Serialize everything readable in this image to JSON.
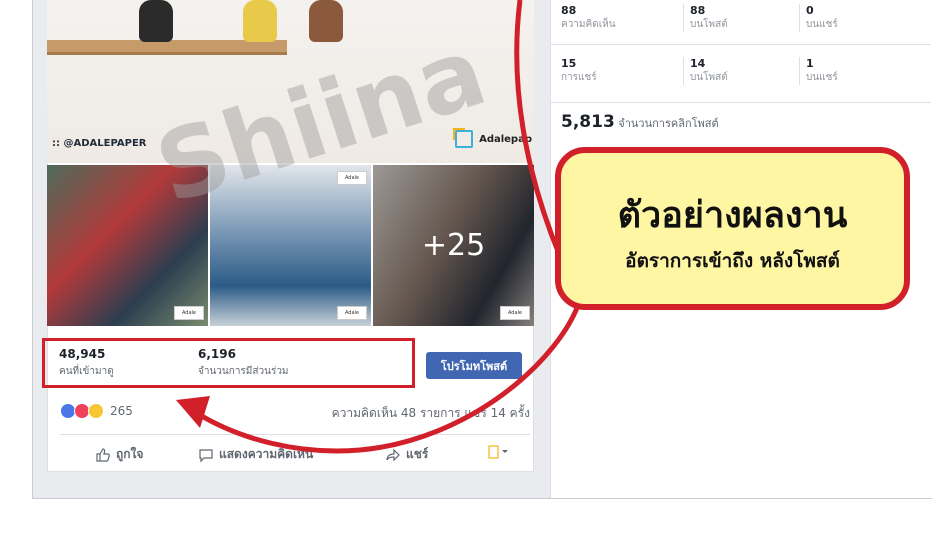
{
  "post": {
    "hero_credit": ":: @ADALEPAPER",
    "brand_name": "Adalepap",
    "thumb_logo_text": "Adale",
    "more_photos": "+25",
    "stats": [
      {
        "value": "48,945",
        "label": "คนที่เข้ามาดู"
      },
      {
        "value": "6,196",
        "label": "จำนวนการมีส่วนร่วม"
      }
    ],
    "promote_label": "โปรโมทโพสต์",
    "reaction_count": "265",
    "comments_shares": "ความคิดเห็น 48 รายการ แชร์ 14 ครั้ง",
    "actions": {
      "like": "ถูกใจ",
      "comment": "แสดงความคิดเห็น",
      "share": "แชร์"
    }
  },
  "metrics": {
    "rows": [
      [
        {
          "value": "88",
          "label": "ความคิดเห็น"
        },
        {
          "value": "88",
          "label": "บนโพสต์"
        },
        {
          "value": "0",
          "label": "บนแชร์"
        }
      ],
      [
        {
          "value": "15",
          "label": "การแชร์"
        },
        {
          "value": "14",
          "label": "บนโพสต์"
        },
        {
          "value": "1",
          "label": "บนแชร์"
        }
      ]
    ],
    "clicks_value": "5,813",
    "clicks_label": "จำนวนการคลิกโพสต์"
  },
  "callout": {
    "title": "ตัวอย่างผลงาน",
    "subtitle": "อัตราการเข้าถึง หลังโพสต์"
  },
  "watermark": "Shiina",
  "colors": {
    "highlight_red": "#d2202a",
    "callout_fill": "#fff6a3",
    "promote_blue": "#4267b2",
    "like_blue": "#4a76e8",
    "love_red": "#f0425a",
    "haha_yellow": "#f7c733"
  }
}
